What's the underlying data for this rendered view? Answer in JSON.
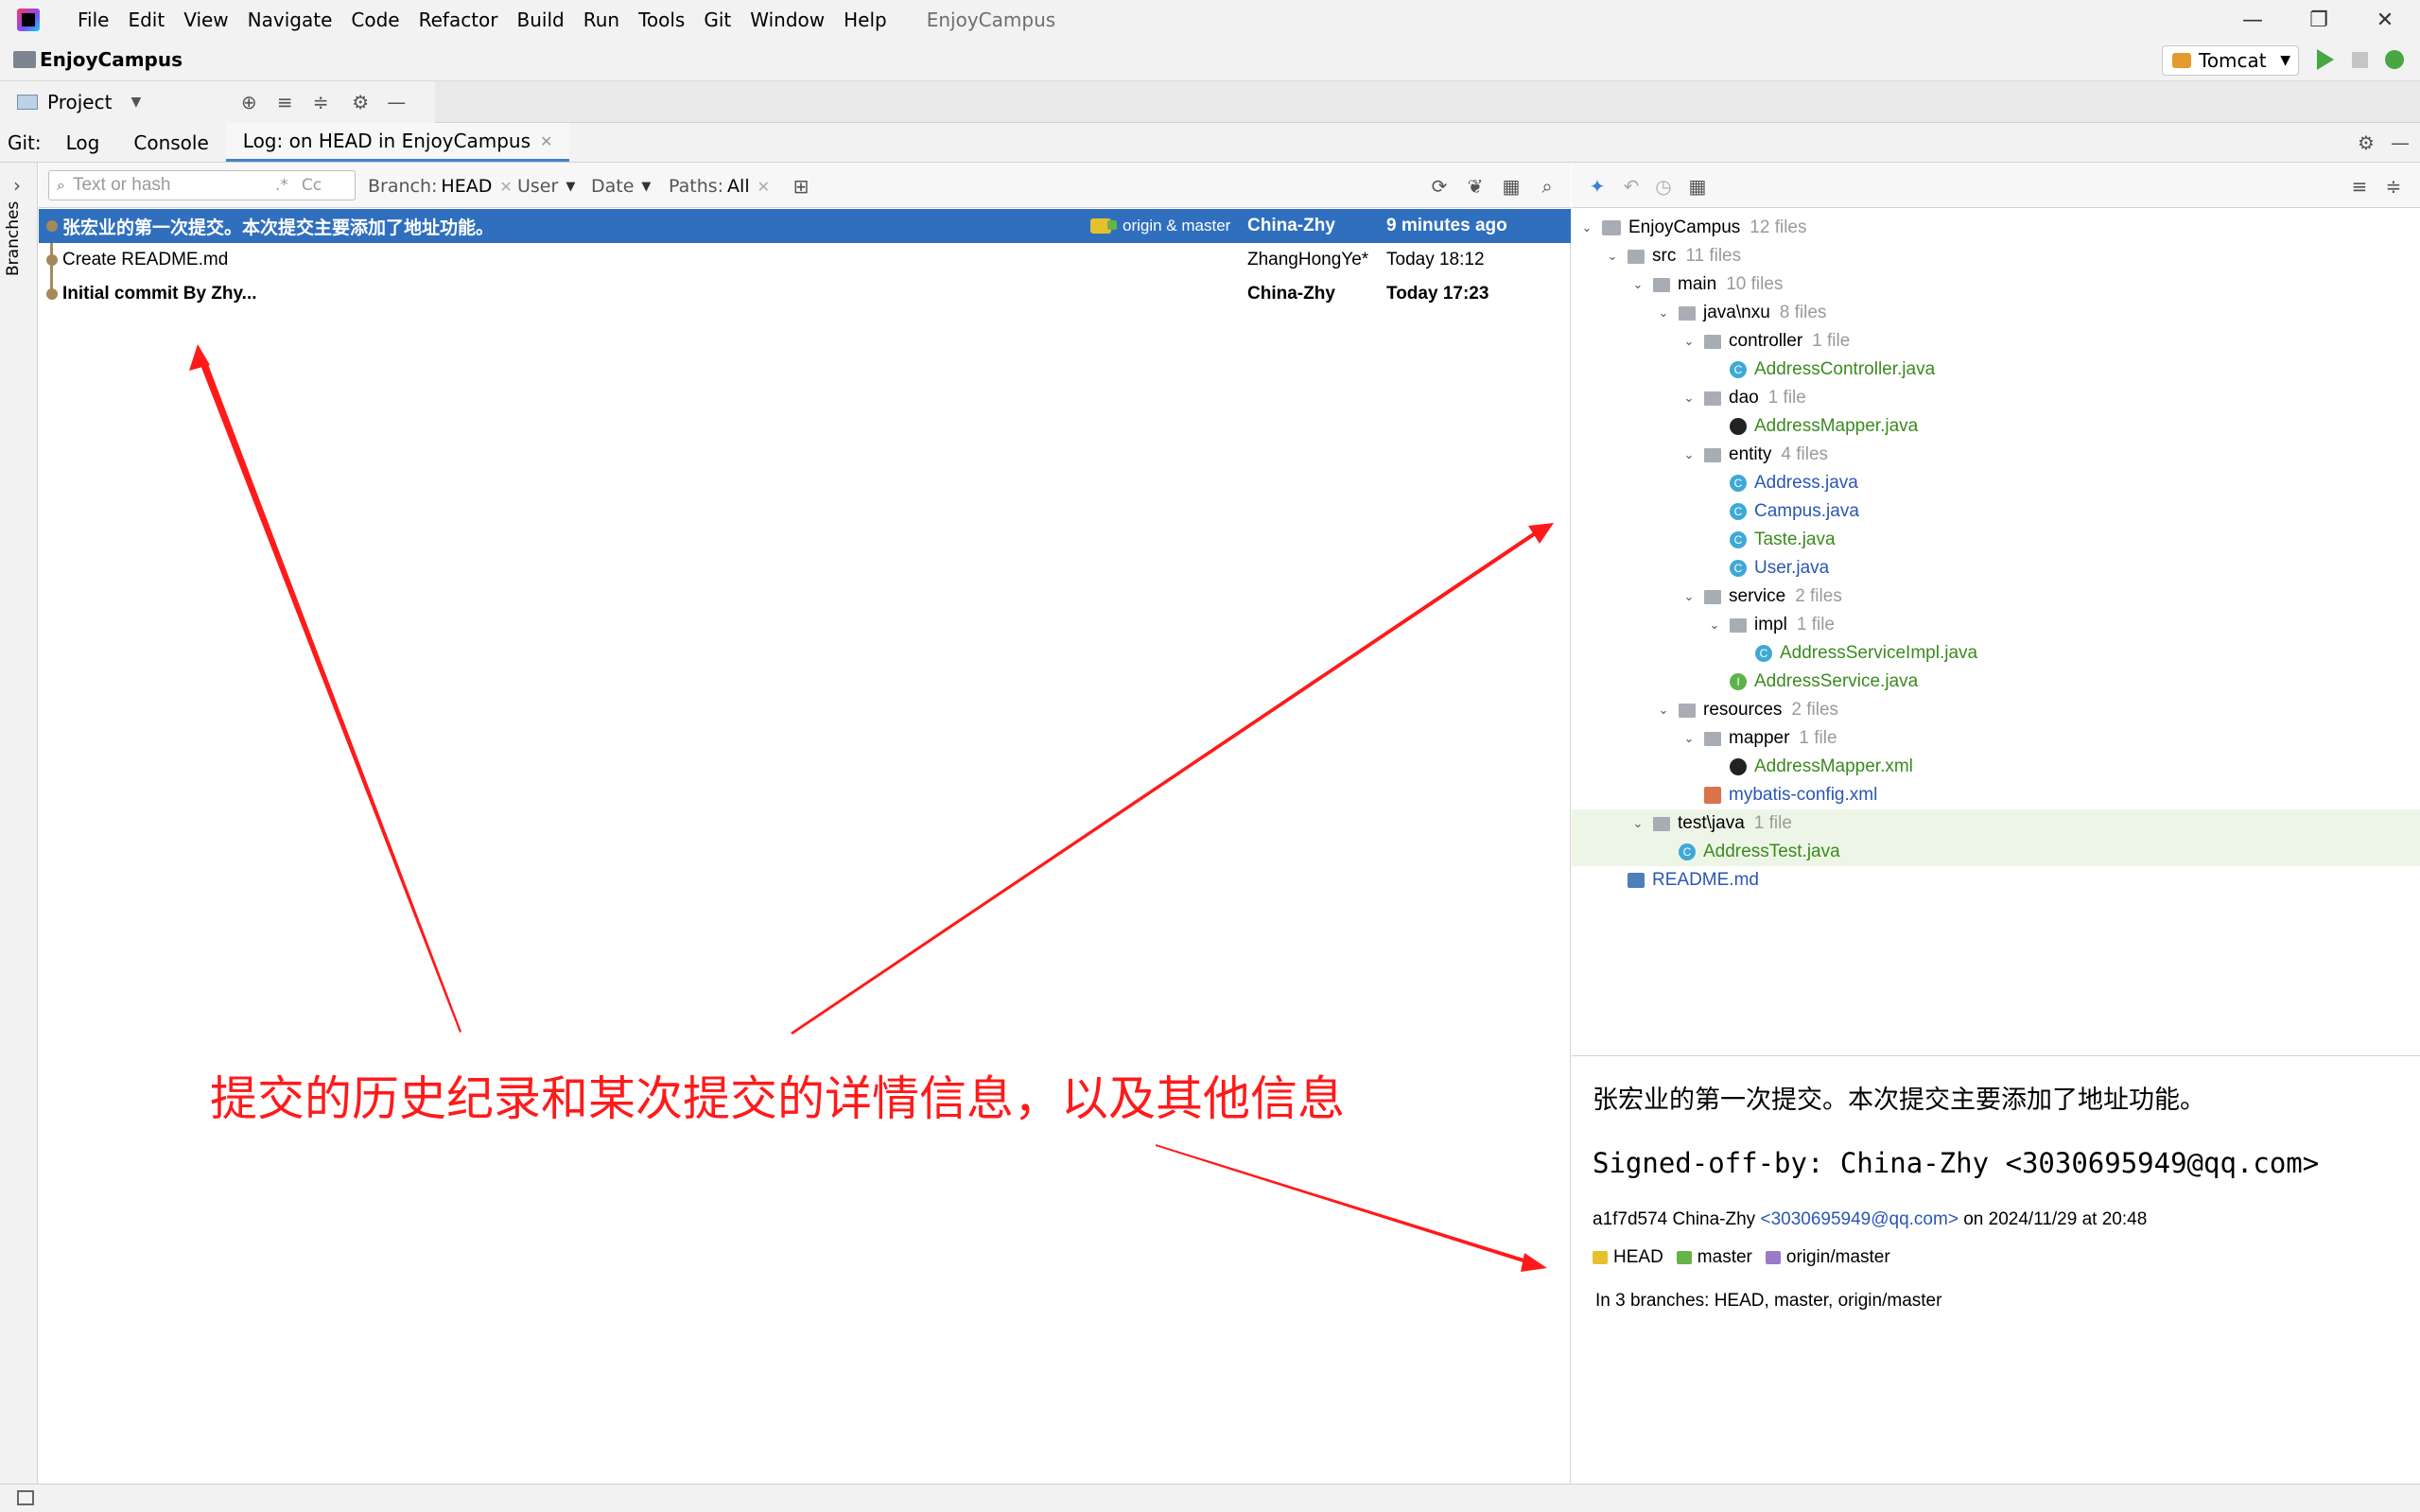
{
  "menubar": {
    "items": [
      "File",
      "Edit",
      "View",
      "Navigate",
      "Code",
      "Refactor",
      "Build",
      "Run",
      "Tools",
      "Git",
      "Window",
      "Help"
    ],
    "window_title": "EnjoyCampus"
  },
  "project": {
    "name": "EnjoyCampus",
    "run_config": "Tomcat",
    "view_dropdown": "Project"
  },
  "git_tabs": {
    "prefix": "Git:",
    "tabs": [
      "Log",
      "Console",
      "Log: on HEAD in EnjoyCampus"
    ]
  },
  "left_stripe": {
    "branches_label": "Branches"
  },
  "log_toolbar": {
    "search_placeholder": "Text or hash",
    "search_regex": ".*",
    "search_case": "Cc",
    "branch_label": "Branch:",
    "branch_value": "HEAD",
    "user_label": "User",
    "date_label": "Date",
    "paths_label": "Paths:",
    "paths_value": "All"
  },
  "commits": [
    {
      "message": "张宏业的第一次提交。本次提交主要添加了地址功能。",
      "refs": "origin & master",
      "author": "China-Zhy",
      "date": "9 minutes ago",
      "bold": true,
      "selected": true
    },
    {
      "message": "Create README.md",
      "refs": "",
      "author": "ZhangHongYe*",
      "date": "Today 18:12",
      "bold": false,
      "selected": false
    },
    {
      "message": "Initial commit By Zhy...",
      "refs": "",
      "author": "China-Zhy",
      "date": "Today 17:23",
      "bold": true,
      "selected": false
    }
  ],
  "annotation": {
    "text": "提交的历史纪录和某次提交的详情信息，以及其他信息",
    "color": "#ff1a1a"
  },
  "file_tree": [
    {
      "name": "EnjoyCampus",
      "count": "12 files",
      "kind": "root",
      "depth": 0,
      "twisty": true
    },
    {
      "name": "src",
      "count": "11 files",
      "kind": "folder",
      "depth": 1,
      "twisty": true
    },
    {
      "name": "main",
      "count": "10 files",
      "kind": "folder",
      "depth": 2,
      "twisty": true
    },
    {
      "name": "java\\nxu",
      "count": "8 files",
      "kind": "folder",
      "depth": 3,
      "twisty": true
    },
    {
      "name": "controller",
      "count": "1 file",
      "kind": "folder",
      "depth": 4,
      "twisty": true
    },
    {
      "name": "AddressController.java",
      "count": "",
      "kind": "class",
      "depth": 5,
      "color": "green"
    },
    {
      "name": "dao",
      "count": "1 file",
      "kind": "folder",
      "depth": 4,
      "twisty": true
    },
    {
      "name": "AddressMapper.java",
      "count": "",
      "kind": "mapper",
      "depth": 5,
      "color": "green"
    },
    {
      "name": "entity",
      "count": "4 files",
      "kind": "folder",
      "depth": 4,
      "twisty": true
    },
    {
      "name": "Address.java",
      "count": "",
      "kind": "class",
      "depth": 5,
      "color": "blue"
    },
    {
      "name": "Campus.java",
      "count": "",
      "kind": "class",
      "depth": 5,
      "color": "blue"
    },
    {
      "name": "Taste.java",
      "count": "",
      "kind": "class",
      "depth": 5,
      "color": "green"
    },
    {
      "name": "User.java",
      "count": "",
      "kind": "class",
      "depth": 5,
      "color": "blue"
    },
    {
      "name": "service",
      "count": "2 files",
      "kind": "folder",
      "depth": 4,
      "twisty": true
    },
    {
      "name": "impl",
      "count": "1 file",
      "kind": "folder",
      "depth": 5,
      "twisty": true
    },
    {
      "name": "AddressServiceImpl.java",
      "count": "",
      "kind": "class",
      "depth": 6,
      "color": "green"
    },
    {
      "name": "AddressService.java",
      "count": "",
      "kind": "interface",
      "depth": 5,
      "color": "green"
    },
    {
      "name": "resources",
      "count": "2 files",
      "kind": "folder",
      "depth": 3,
      "twisty": true
    },
    {
      "name": "mapper",
      "count": "1 file",
      "kind": "folder",
      "depth": 4,
      "twisty": true
    },
    {
      "name": "AddressMapper.xml",
      "count": "",
      "kind": "mapper",
      "depth": 5,
      "color": "green"
    },
    {
      "name": "mybatis-config.xml",
      "count": "",
      "kind": "xml",
      "depth": 4,
      "color": "blue"
    },
    {
      "name": "test\\java",
      "count": "1 file",
      "kind": "folder",
      "depth": 2,
      "twisty": true,
      "highlight": true
    },
    {
      "name": "AddressTest.java",
      "count": "",
      "kind": "class",
      "depth": 3,
      "color": "green",
      "highlight": true
    },
    {
      "name": "README.md",
      "count": "",
      "kind": "md",
      "depth": 1,
      "color": "blue"
    }
  ],
  "details": {
    "subject": "张宏业的第一次提交。本次提交主要添加了地址功能。",
    "signed_off": "Signed-off-by: China-Zhy <3030695949@qq.com>",
    "hash": "a1f7d574",
    "author": "China-Zhy",
    "email": "<3030695949@qq.com>",
    "date_text": "on 2024/11/29 at 20:48",
    "refs": [
      "HEAD",
      "master",
      "origin/master"
    ],
    "branches": "In 3 branches: HEAD, master, origin/master"
  }
}
